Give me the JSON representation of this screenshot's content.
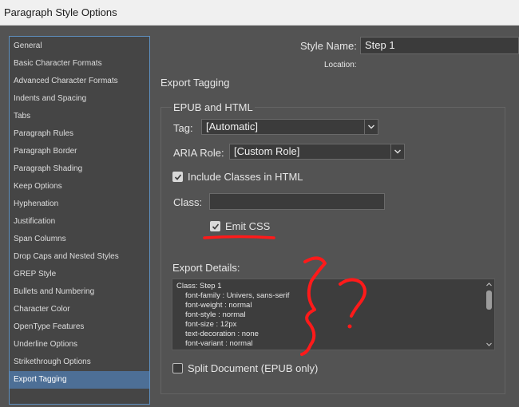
{
  "window": {
    "title": "Paragraph Style Options"
  },
  "sidebar": {
    "items": [
      {
        "label": "General"
      },
      {
        "label": "Basic Character Formats"
      },
      {
        "label": "Advanced Character Formats"
      },
      {
        "label": "Indents and Spacing"
      },
      {
        "label": "Tabs"
      },
      {
        "label": "Paragraph Rules"
      },
      {
        "label": "Paragraph Border"
      },
      {
        "label": "Paragraph Shading"
      },
      {
        "label": "Keep Options"
      },
      {
        "label": "Hyphenation"
      },
      {
        "label": "Justification"
      },
      {
        "label": "Span Columns"
      },
      {
        "label": "Drop Caps and Nested Styles"
      },
      {
        "label": "GREP Style"
      },
      {
        "label": "Bullets and Numbering"
      },
      {
        "label": "Character Color"
      },
      {
        "label": "OpenType Features"
      },
      {
        "label": "Underline Options"
      },
      {
        "label": "Strikethrough Options"
      },
      {
        "label": "Export Tagging",
        "selected": true
      }
    ]
  },
  "header": {
    "style_name_label": "Style Name:",
    "style_name_value": "Step 1",
    "location_label": "Location:"
  },
  "section": {
    "title": "Export Tagging"
  },
  "epub": {
    "group_label": "EPUB and HTML",
    "tag_label": "Tag:",
    "tag_value": "[Automatic]",
    "aria_label": "ARIA Role:",
    "aria_value": "[Custom Role]",
    "include_classes_label": "Include Classes in HTML",
    "include_classes_checked": true,
    "class_label": "Class:",
    "class_value": "",
    "emit_css_label": "Emit CSS",
    "emit_css_checked": true
  },
  "export_details": {
    "label": "Export Details:",
    "lines": [
      "Class: Step 1",
      "font-family : Univers, sans-serif",
      "font-weight : normal",
      "font-style : normal",
      "font-size : 12px",
      "text-decoration : none",
      "font-variant : normal"
    ]
  },
  "split_document": {
    "label": "Split Document (EPUB only)",
    "checked": false
  },
  "annotation": {
    "color": "#ff1a1a"
  }
}
